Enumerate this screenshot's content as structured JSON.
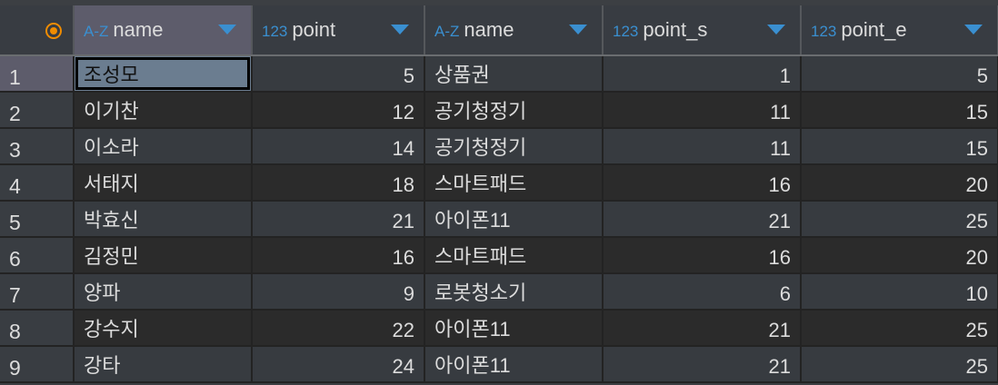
{
  "columns": [
    {
      "type": "A-Z",
      "label": "name"
    },
    {
      "type": "123",
      "label": "point"
    },
    {
      "type": "A-Z",
      "label": "name"
    },
    {
      "type": "123",
      "label": "point_s"
    },
    {
      "type": "123",
      "label": "point_e"
    }
  ],
  "rows": [
    [
      "1",
      "조성모",
      "5",
      "상품권",
      "1",
      "5"
    ],
    [
      "2",
      "이기찬",
      "12",
      "공기청정기",
      "11",
      "15"
    ],
    [
      "3",
      "이소라",
      "14",
      "공기청정기",
      "11",
      "15"
    ],
    [
      "4",
      "서태지",
      "18",
      "스마트패드",
      "16",
      "20"
    ],
    [
      "5",
      "박효신",
      "21",
      "아이폰11",
      "21",
      "25"
    ],
    [
      "6",
      "김정민",
      "16",
      "스마트패드",
      "16",
      "20"
    ],
    [
      "7",
      "양파",
      "9",
      "로봇청소기",
      "6",
      "10"
    ],
    [
      "8",
      "강수지",
      "22",
      "아이폰11",
      "21",
      "25"
    ],
    [
      "9",
      "강타",
      "24",
      "아이폰11",
      "21",
      "25"
    ]
  ]
}
